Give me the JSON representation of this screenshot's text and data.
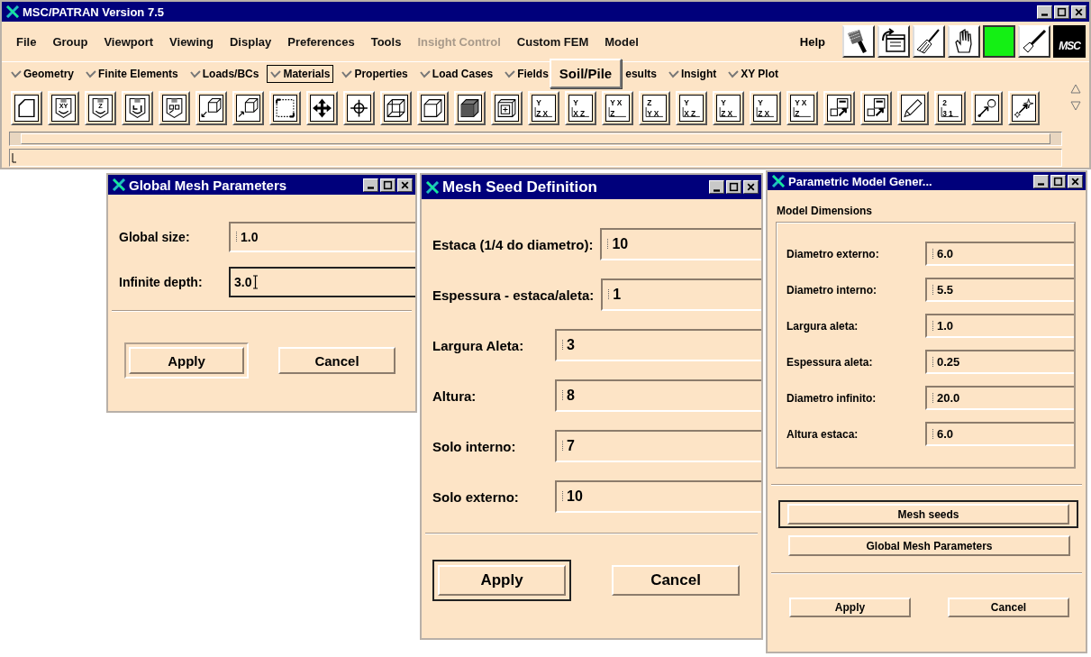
{
  "main_window": {
    "title": "MSC/PATRAN Version 7.5",
    "menu": [
      {
        "label": "File",
        "disabled": false
      },
      {
        "label": "Group",
        "disabled": false
      },
      {
        "label": "Viewport",
        "disabled": false
      },
      {
        "label": "Viewing",
        "disabled": false
      },
      {
        "label": "Display",
        "disabled": false
      },
      {
        "label": "Preferences",
        "disabled": false
      },
      {
        "label": "Tools",
        "disabled": false
      },
      {
        "label": "Insight Control",
        "disabled": true
      },
      {
        "label": "Custom FEM",
        "disabled": false
      },
      {
        "label": "Model",
        "disabled": false
      }
    ],
    "help": "Help",
    "logo_text": "MSC",
    "applications": [
      {
        "label": "Geometry",
        "selected": false,
        "kind": "menu"
      },
      {
        "label": "Finite Elements",
        "selected": false,
        "kind": "menu"
      },
      {
        "label": "Loads/BCs",
        "selected": false,
        "kind": "menu"
      },
      {
        "label": "Materials",
        "selected": true,
        "kind": "menu"
      },
      {
        "label": "Properties",
        "selected": false,
        "kind": "menu"
      },
      {
        "label": "Load Cases",
        "selected": false,
        "kind": "menu"
      },
      {
        "label": "Fields",
        "selected": false,
        "kind": "menu"
      },
      {
        "label": "Soil/Pile",
        "selected": false,
        "kind": "popup"
      },
      {
        "label": "esults",
        "selected": false,
        "kind": "cut"
      },
      {
        "label": "Insight",
        "selected": false,
        "kind": "menu"
      },
      {
        "label": "XY Plot",
        "selected": false,
        "kind": "menu"
      }
    ],
    "toolbar": [
      {
        "kind": "polygon"
      },
      {
        "kind": "rotate",
        "labels": [
          "XY"
        ]
      },
      {
        "kind": "rotate",
        "labels": [
          "Z"
        ]
      },
      {
        "kind": "rotate"
      },
      {
        "kind": "zoom-box"
      },
      {
        "kind": "zoom-in"
      },
      {
        "kind": "zoom-out"
      },
      {
        "kind": "fit"
      },
      {
        "kind": "pan"
      },
      {
        "kind": "center"
      },
      {
        "kind": "wireframe"
      },
      {
        "kind": "hidden"
      },
      {
        "kind": "shaded"
      },
      {
        "kind": "plus-cube"
      },
      {
        "kind": "axes",
        "labels": [
          "Y",
          "Z X"
        ]
      },
      {
        "kind": "axes",
        "labels": [
          "Y",
          "X Z"
        ]
      },
      {
        "kind": "axes",
        "labels": [
          "Y X",
          "Z"
        ]
      },
      {
        "kind": "axes",
        "labels": [
          "Z",
          "Y X"
        ]
      },
      {
        "kind": "axes",
        "labels": [
          "Y",
          "X Z"
        ]
      },
      {
        "kind": "axes",
        "labels": [
          "Y",
          "Z X"
        ]
      },
      {
        "kind": "axes",
        "labels": [
          "Y",
          "Z X"
        ]
      },
      {
        "kind": "axes",
        "labels": [
          "Y X",
          "Z"
        ]
      },
      {
        "kind": "panel"
      },
      {
        "kind": "panel"
      },
      {
        "kind": "pencil"
      },
      {
        "kind": "axes",
        "labels": [
          "2",
          "3 1"
        ]
      },
      {
        "kind": "node"
      },
      {
        "kind": "spark"
      }
    ]
  },
  "dialogs": [
    {
      "title": "Global Mesh Parameters",
      "fields": [
        {
          "label": "Global size:",
          "value": "1.0",
          "focused": false
        },
        {
          "label": "Infinite depth:",
          "value": "3.0",
          "focused": true
        }
      ],
      "buttons": [
        {
          "label": "Apply",
          "default": true
        },
        {
          "label": "Cancel",
          "default": false
        }
      ]
    },
    {
      "title": "Mesh Seed Definition",
      "fields": [
        {
          "label": "Estaca (1/4 do diametro):",
          "value": "10",
          "focused": false
        },
        {
          "label": "Espessura - estaca/aleta:",
          "value": "1",
          "focused": false
        },
        {
          "label": "Largura Aleta:",
          "value": "3",
          "focused": false
        },
        {
          "label": "Altura:",
          "value": "8",
          "focused": false
        },
        {
          "label": "Solo interno:",
          "value": "7",
          "focused": false
        },
        {
          "label": "Solo externo:",
          "value": "10",
          "focused": false
        }
      ],
      "buttons": [
        {
          "label": "Apply",
          "default": true
        },
        {
          "label": "Cancel",
          "default": false
        }
      ]
    },
    {
      "title": "Parametric Model Gener...",
      "group_title": "Model Dimensions",
      "fields": [
        {
          "label": "Diametro externo:",
          "value": "6.0",
          "focused": false
        },
        {
          "label": "Diametro interno:",
          "value": "5.5",
          "focused": false
        },
        {
          "label": "Largura aleta:",
          "value": "1.0",
          "focused": false
        },
        {
          "label": "Espessura aleta:",
          "value": "0.25",
          "focused": false
        },
        {
          "label": "Diametro infinito:",
          "value": "20.0",
          "focused": false
        },
        {
          "label": "Altura estaca:",
          "value": "6.0",
          "focused": false
        }
      ],
      "actions": [
        {
          "label": "Mesh seeds",
          "default": true
        },
        {
          "label": "Global Mesh Parameters",
          "default": false
        }
      ],
      "buttons": [
        {
          "label": "Apply",
          "default": false
        },
        {
          "label": "Cancel",
          "default": false
        }
      ]
    }
  ]
}
